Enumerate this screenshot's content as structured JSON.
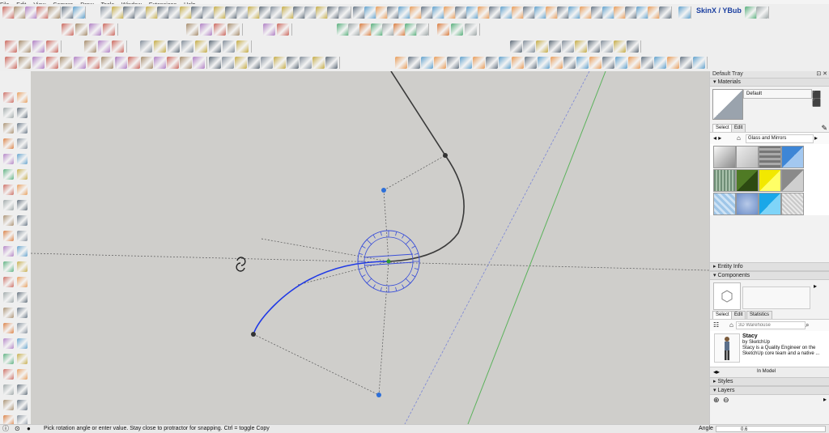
{
  "menu": [
    "File",
    "Edit",
    "View",
    "Camera",
    "Draw",
    "Tools",
    "Window",
    "Extensions",
    "Help"
  ],
  "extension": {
    "label": "SkinX / YBub"
  },
  "tray": {
    "title": "Default Tray",
    "materials": {
      "header": "Materials",
      "name_value": "Default",
      "tab_select": "Select",
      "tab_edit": "Edit",
      "library": "Glass and Mirrors"
    },
    "entity_info": {
      "header": "Entity Info"
    },
    "components": {
      "header": "Components",
      "tab_select": "Select",
      "tab_edit": "Edit",
      "tab_statistics": "Statistics",
      "search_placeholder": "3D Warehouse",
      "item_title": "Stacy",
      "item_by": "by SketchUp",
      "item_desc": "Stacy is a Quality Engineer on the SketchUp core team and a native ...",
      "in_model": "In Model"
    },
    "styles": {
      "header": "Styles"
    },
    "layers": {
      "header": "Layers"
    }
  },
  "status": {
    "message": "Pick rotation angle or enter value.  Stay close to protractor for snapping. Ctrl = toggle Copy",
    "measure_label": "Angle",
    "measure_value": "0.6"
  },
  "colors": {
    "viewport_bg": "#cfcecb",
    "curve_black": "#3a3a3a",
    "curve_blue": "#1f39e6",
    "protractor": "#3a4fd8",
    "green_axis": "#5cb25c",
    "blue_axis": "#7b86d6"
  }
}
